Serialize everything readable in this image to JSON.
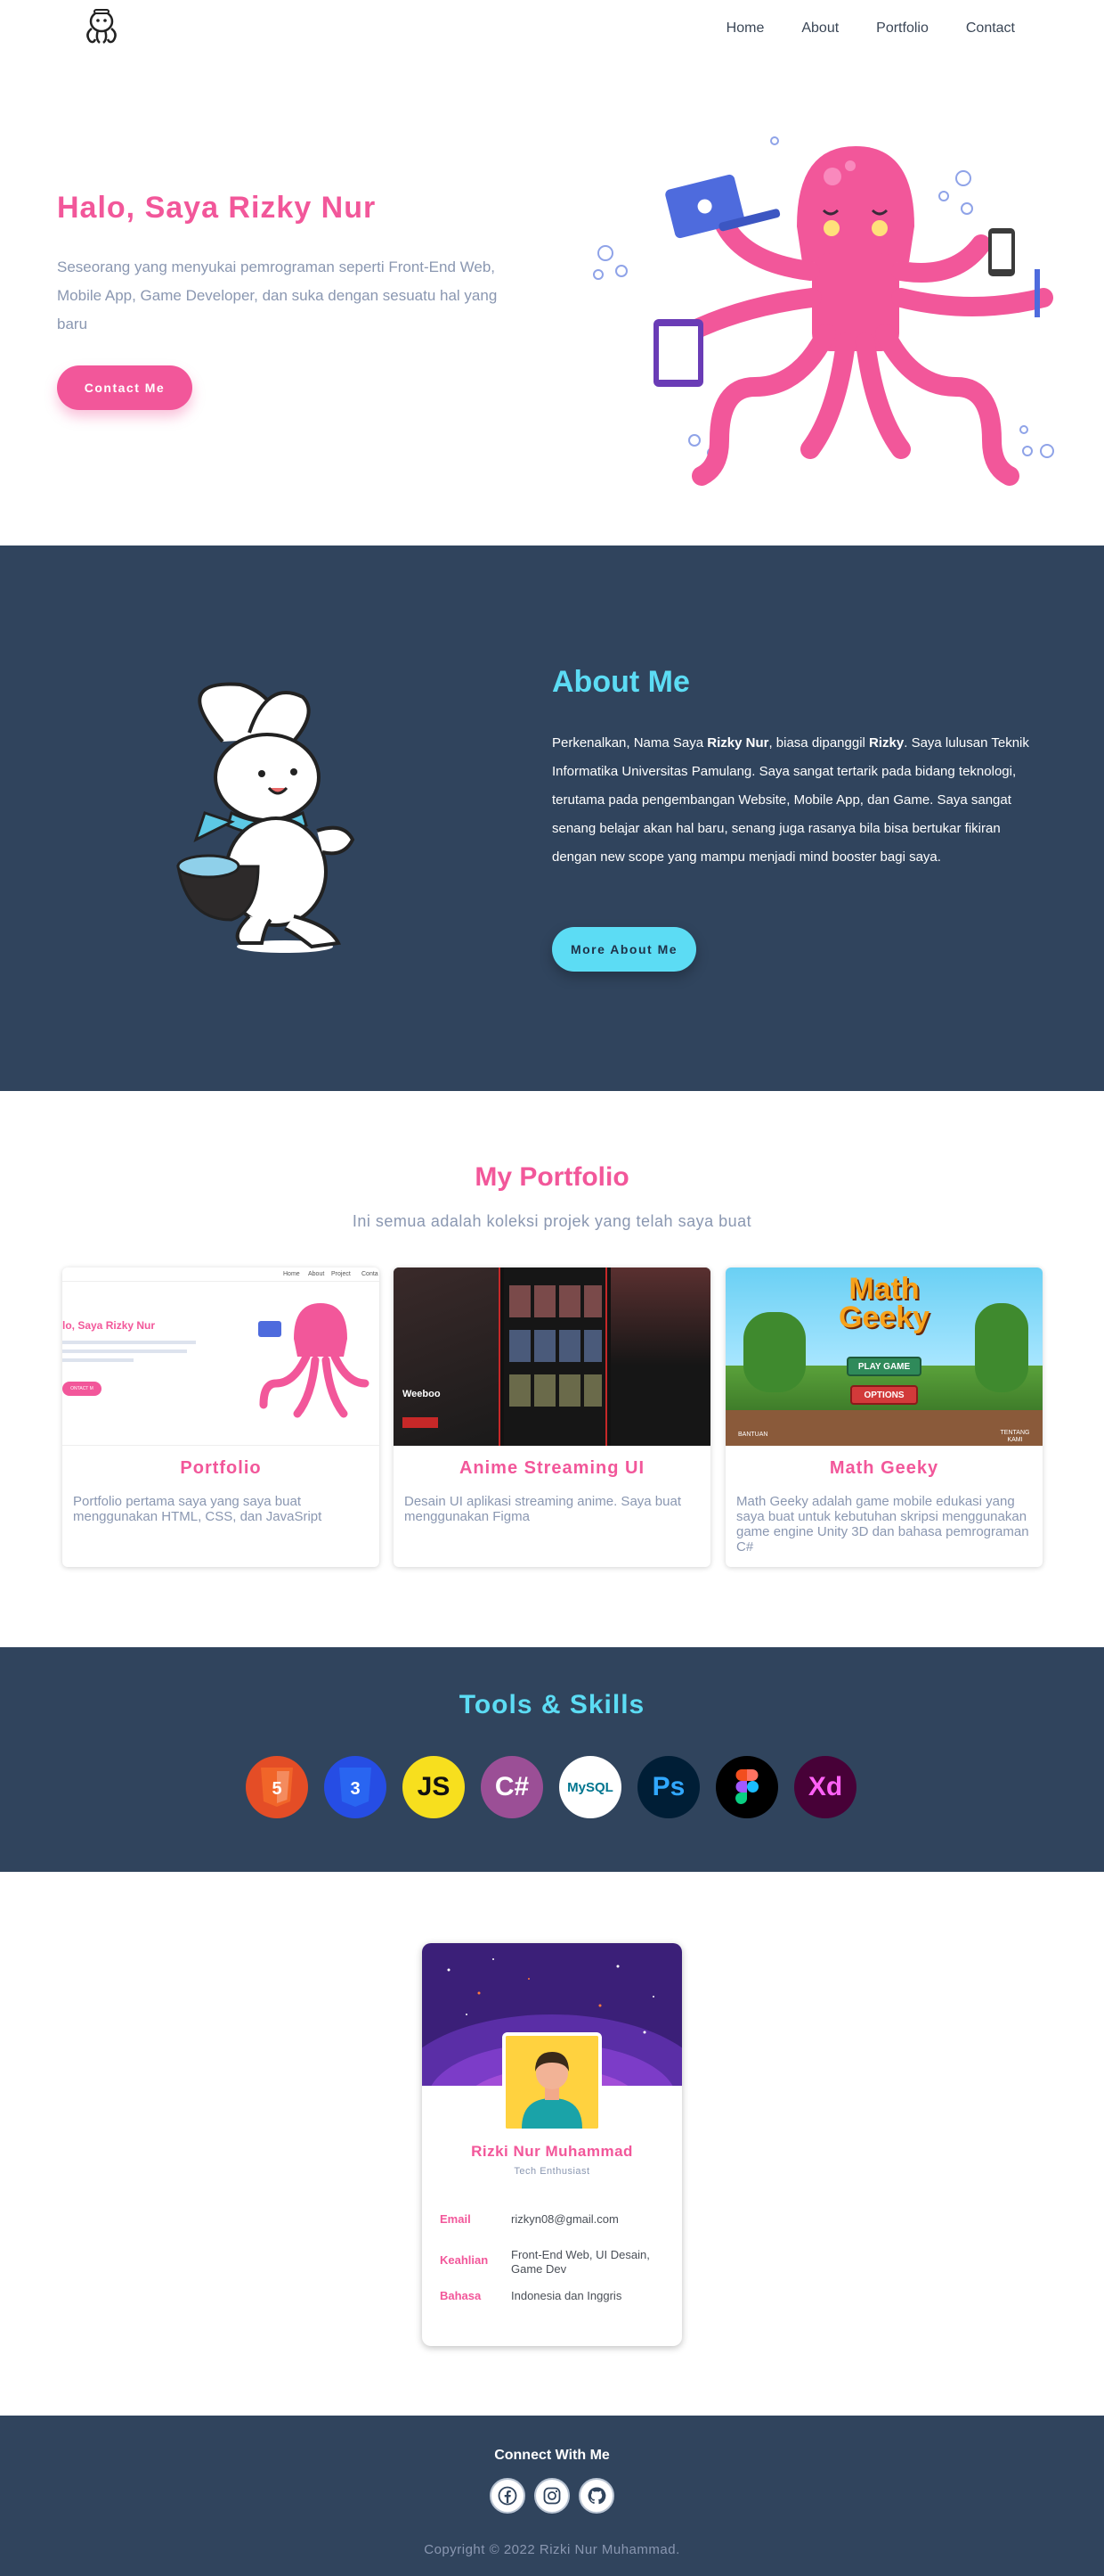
{
  "nav": {
    "items": [
      {
        "label": "Home"
      },
      {
        "label": "About"
      },
      {
        "label": "Portfolio"
      },
      {
        "label": "Contact"
      }
    ]
  },
  "hero": {
    "title": "Halo, Saya Rizky Nur",
    "description": "Seseorang yang menyukai pemrograman seperti Front-End Web, Mobile App, Game Developer, dan suka dengan sesuatu hal yang baru",
    "button": "Contact Me"
  },
  "about": {
    "title": "About Me",
    "text_1": "Perkenalkan, Nama Saya ",
    "name_bold": "Rizky Nur",
    "text_2": ", biasa dipanggil ",
    "nick_bold": "Rizky",
    "text_3": ". Saya lulusan Teknik Informatika Universitas Pamulang. Saya sangat tertarik pada bidang teknologi, terutama pada pengembangan Website, Mobile App, dan Game. Saya sangat senang belajar akan hal baru, senang juga rasanya bila bisa bertukar fikiran dengan new scope yang mampu menjadi mind booster bagi saya.",
    "button": "More About Me"
  },
  "portfolio": {
    "title": "My Portfolio",
    "subtitle": "Ini semua adalah koleksi projek yang telah saya buat",
    "cards": [
      {
        "title": "Portfolio",
        "description": "Portfolio pertama saya yang saya buat menggunakan HTML, CSS, dan JavaSript",
        "thumb_title": "lo, Saya Rizky Nur",
        "thumb_button": "ONTACT M",
        "thumb_nav": [
          "Home",
          "About",
          "Project",
          "Conta"
        ]
      },
      {
        "title": "Anime Streaming UI",
        "description": "Desain UI aplikasi streaming anime. Saya buat menggunakan Figma",
        "thumb_label": "Weeboo"
      },
      {
        "title": "Math Geeky",
        "description": "Math Geeky adalah game mobile edukasi yang saya buat untuk kebutuhan skripsi menggunakan game engine Unity 3D dan bahasa pemrograman C#",
        "thumb_logo_1": "Math",
        "thumb_logo_2": "Geeky",
        "thumb_play": "PLAY GAME",
        "thumb_options": "OPTIONS",
        "thumb_left": "BANTUAN",
        "thumb_right": "TENTANG KAMI"
      }
    ]
  },
  "skills": {
    "title": "Tools & Skills",
    "items": [
      {
        "name": "HTML5",
        "icon": "html5-icon",
        "label": "5",
        "color": "#e44d26"
      },
      {
        "name": "CSS3",
        "icon": "css3-icon",
        "label": "3",
        "color": "#264de4"
      },
      {
        "name": "JavaScript",
        "icon": "javascript-icon",
        "label": "JS",
        "color": "#f7df1e"
      },
      {
        "name": "C#",
        "icon": "csharp-icon",
        "label": "C#",
        "color": "#9b4f96"
      },
      {
        "name": "MySQL",
        "icon": "mysql-icon",
        "label": "MySQL",
        "color": "#ffffff"
      },
      {
        "name": "Photoshop",
        "icon": "photoshop-icon",
        "label": "Ps",
        "color": "#001e36"
      },
      {
        "name": "Figma",
        "icon": "figma-icon",
        "label": "",
        "color": "#000000"
      },
      {
        "name": "Adobe XD",
        "icon": "xd-icon",
        "label": "Xd",
        "color": "#470137"
      }
    ]
  },
  "profile": {
    "name": "Rizki Nur Muhammad",
    "role": "Tech Enthusiast",
    "rows": [
      {
        "key": "Email",
        "value": "rizkyn08@gmail.com"
      },
      {
        "key": "Keahlian",
        "value": "Front-End Web, UI Desain, Game Dev"
      },
      {
        "key": "Bahasa",
        "value": "Indonesia dan Inggris"
      }
    ]
  },
  "footer": {
    "title": "Connect With Me",
    "icons": [
      "facebook-icon",
      "instagram-icon",
      "github-icon"
    ],
    "copyright": "Copyright © 2022 Rizki Nur Muhammad."
  },
  "colors": {
    "pink": "#f2579a",
    "cyan": "#5cdcf4",
    "navy": "#30445d",
    "muted": "#8a97b1"
  }
}
